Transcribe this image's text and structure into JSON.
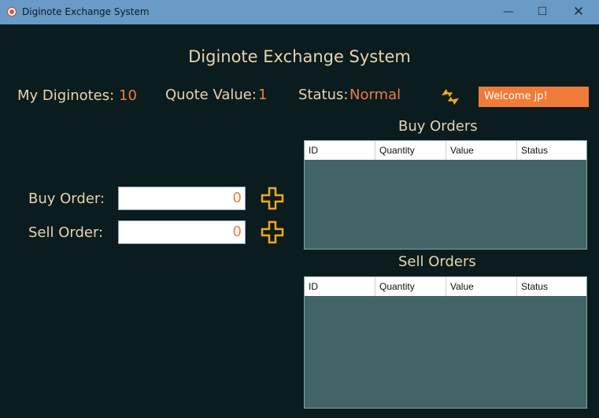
{
  "window": {
    "title": "Diginote Exchange System",
    "minimize": "—",
    "maximize": "☐",
    "close": "✕"
  },
  "header": {
    "title": "Diginote Exchange System"
  },
  "stats": {
    "diginotes_label": "My Diginotes:",
    "diginotes_value": "10",
    "quote_label": "Quote Value:",
    "quote_value": "1",
    "status_label": "Status:",
    "status_value": "Normal"
  },
  "welcome": "Welcome jp!",
  "orders": {
    "buy_label": "Buy Order:",
    "buy_value": "0",
    "sell_label": "Sell Order:",
    "sell_value": "0"
  },
  "buy_table": {
    "title": "Buy Orders",
    "columns": [
      "ID",
      "Quantity",
      "Value",
      "Status"
    ]
  },
  "sell_table": {
    "title": "Sell Orders",
    "columns": [
      "ID",
      "Quantity",
      "Value",
      "Status"
    ]
  },
  "colors": {
    "background": "#0b1c1e",
    "accent": "#ef7b3f",
    "text": "#e6d3b0",
    "icon": "#f5a623",
    "table_body": "#426467",
    "titlebar": "#6a9ac6"
  },
  "icons": {
    "app": "app-logo-icon",
    "refresh": "refresh-icon",
    "add": "plus-icon"
  }
}
